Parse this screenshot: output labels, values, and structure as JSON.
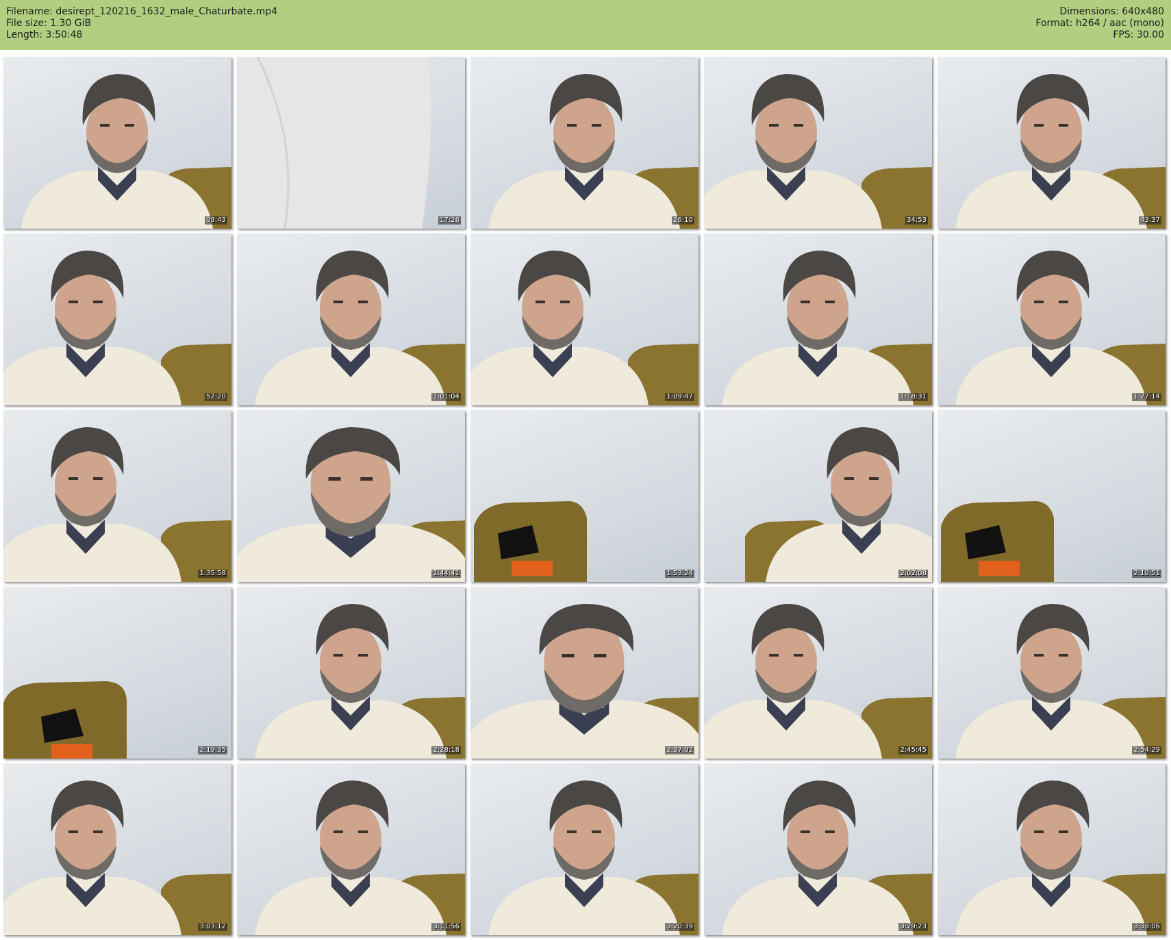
{
  "header": {
    "filename": "Filename: desirept_120216_1632_male_Chaturbate.mp4",
    "file_size": "File size: 1.30 GiB",
    "length": "Length: 3:50:48",
    "dimensions": "Dimensions: 640x480",
    "format": "Format: h264 / aac (mono)",
    "fps": "FPS: 30.00"
  },
  "colors": {
    "header_bg": "#b1cf80",
    "page_bg": "#ffffff"
  },
  "thumbnails": [
    {
      "time": "08:43",
      "scene": "man-center"
    },
    {
      "time": "17:26",
      "scene": "sweater-closeup"
    },
    {
      "time": "26:10",
      "scene": "man-center"
    },
    {
      "time": "34:53",
      "scene": "man-left"
    },
    {
      "time": "43:37",
      "scene": "man-center"
    },
    {
      "time": "52:20",
      "scene": "man-left"
    },
    {
      "time": "1:01:04",
      "scene": "man-center"
    },
    {
      "time": "1:09:47",
      "scene": "man-left"
    },
    {
      "time": "1:18:31",
      "scene": "man-center"
    },
    {
      "time": "1:27:14",
      "scene": "man-center"
    },
    {
      "time": "1:35:58",
      "scene": "man-left"
    },
    {
      "time": "1:44:41",
      "scene": "man-close"
    },
    {
      "time": "1:53:24",
      "scene": "empty-chair"
    },
    {
      "time": "2:02:08",
      "scene": "man-right"
    },
    {
      "time": "2:10:51",
      "scene": "empty-chair"
    },
    {
      "time": "2:19:35",
      "scene": "empty-chair-left"
    },
    {
      "time": "2:28:18",
      "scene": "man-center"
    },
    {
      "time": "2:37:02",
      "scene": "man-close"
    },
    {
      "time": "2:45:45",
      "scene": "man-left"
    },
    {
      "time": "2:54:29",
      "scene": "man-center"
    },
    {
      "time": "3:03:12",
      "scene": "man-left"
    },
    {
      "time": "3:11:56",
      "scene": "man-center"
    },
    {
      "time": "3:20:39",
      "scene": "man-center"
    },
    {
      "time": "3:29:23",
      "scene": "man-center"
    },
    {
      "time": "3:38:06",
      "scene": "man-center"
    }
  ]
}
